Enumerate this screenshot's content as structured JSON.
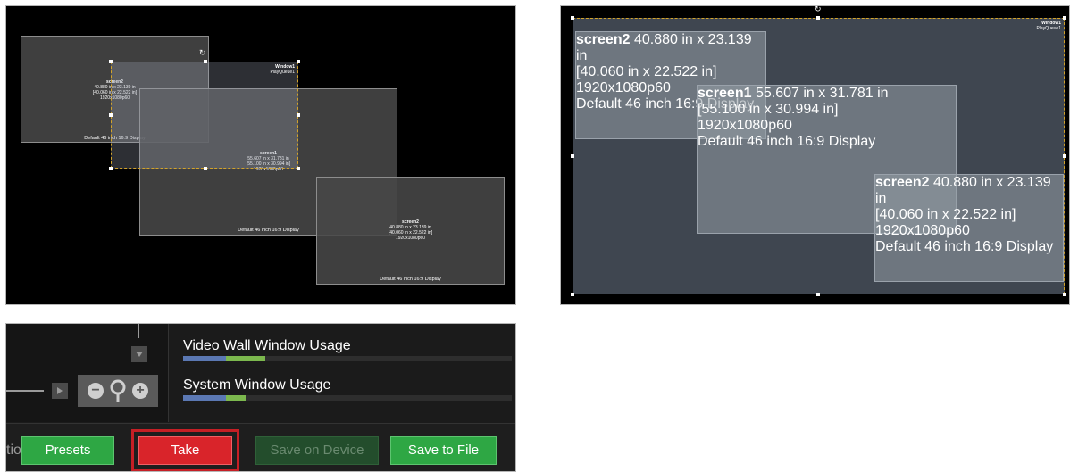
{
  "left_canvas": {
    "screens": [
      {
        "name": "screen2",
        "size_in": "40.880 in x 23.139 in",
        "offset_in": "[40.060 in x 22.522 in]",
        "resolution": "1920x1080p60",
        "display": "Default 46 inch 16:9 Display"
      },
      {
        "name": "screen1",
        "size_in": "55.607 in x 31.781 in",
        "offset_in": "[55.100 in x 30.994 in]",
        "resolution": "1920x1080p60",
        "display": "Default 46 inch 16:9 Display"
      },
      {
        "name": "screen2",
        "size_in": "40.880 in x 23.139 in",
        "offset_in": "[40.060 in x 22.522 in]",
        "resolution": "1920x1080p60",
        "display": "Default 46 inch 16:9 Display"
      }
    ],
    "window": {
      "name": "Window1",
      "queue": "PlayQueue1"
    }
  },
  "right_canvas": {
    "screens": [
      {
        "name": "screen2",
        "size_in": "40.880 in x 23.139 in",
        "offset_in": "[40.060 in x 22.522 in]",
        "resolution": "1920x1080p60",
        "display": "Default 46 inch 16:9 Display"
      },
      {
        "name": "screen1",
        "size_in": "55.607 in x 31.781 in",
        "offset_in": "[55.100 in x 30.994 in]",
        "resolution": "1920x1080p60",
        "display": "Default 46 inch 16:9 Display"
      },
      {
        "name": "screen2",
        "size_in": "40.880 in x 23.139 in",
        "offset_in": "[40.060 in x 22.522 in]",
        "resolution": "1920x1080p60",
        "display": "Default 46 inch 16:9 Display"
      }
    ],
    "window": {
      "name": "Window1",
      "queue": "PlayQueue1"
    }
  },
  "panel": {
    "video_wall_usage": {
      "label": "Video Wall Window Usage",
      "blue_fraction": 0.13,
      "green_fraction": 0.12
    },
    "system_usage": {
      "label": "System Window Usage",
      "blue_fraction": 0.13,
      "green_fraction": 0.06
    },
    "cut_text": "tio",
    "buttons": {
      "presets": "Presets",
      "take": "Take",
      "save_device": "Save on Device",
      "save_file": "Save to File"
    },
    "zoom": {
      "minus": "−",
      "plus": "+"
    },
    "colors": {
      "usage_blue": "#5b78b3",
      "usage_green": "#7cb84e",
      "take_red": "#d9242a",
      "button_green": "#2ea744"
    }
  }
}
